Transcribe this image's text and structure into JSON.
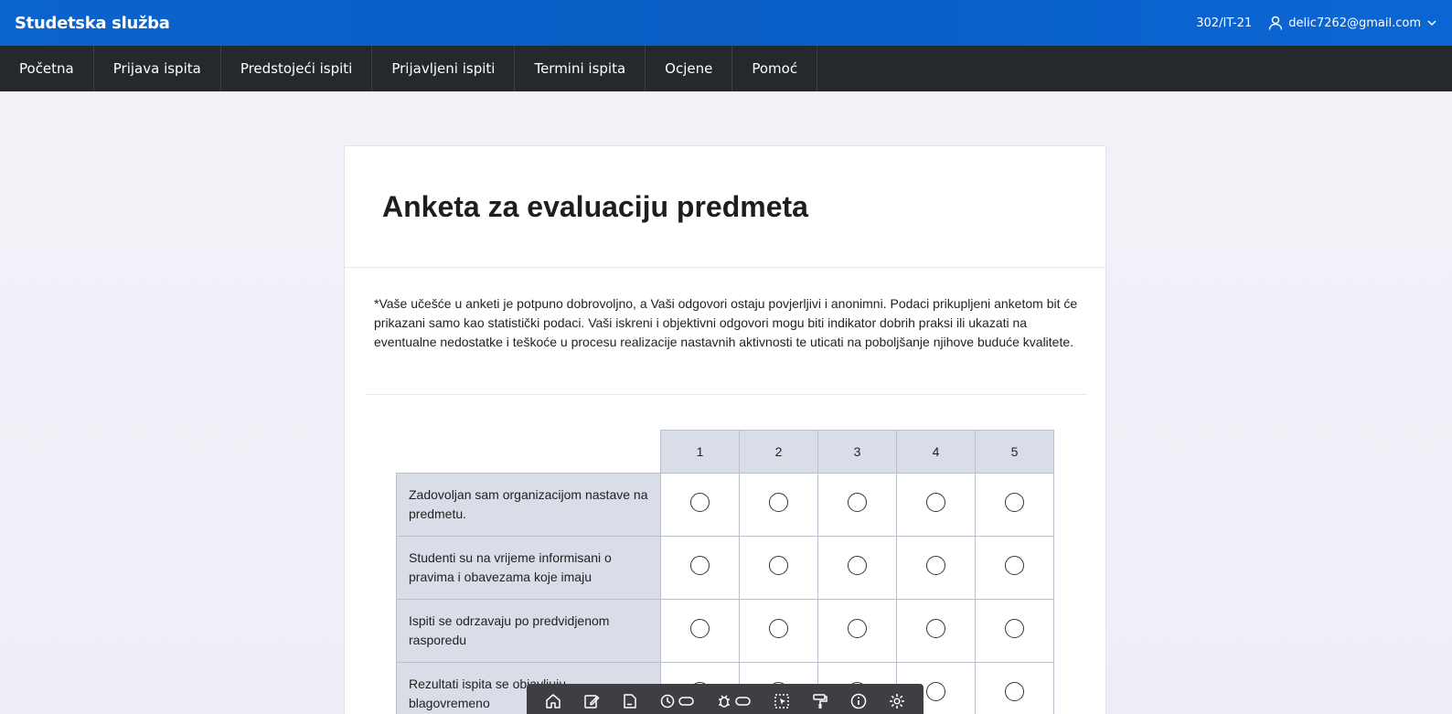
{
  "header": {
    "brand": "Studetska služba",
    "student_code": "302/IT-21",
    "user_email": "delic7262@gmail.com"
  },
  "nav": {
    "items": [
      "Početna",
      "Prijava ispita",
      "Predstojeći ispiti",
      "Prijavljeni ispiti",
      "Termini ispita",
      "Ocjene",
      "Pomoć"
    ]
  },
  "survey": {
    "title": "Anketa za evaluaciju predmeta",
    "intro": "*Vaše učešće u anketi je potpuno dobrovoljno, a Vaši odgovori ostaju povjerljivi i anonimni. Podaci prikupljeni anketom bit će prikazani samo kao statistički podaci. Vaši iskreni i objektivni odgovori mogu biti indikator dobrih praksi ili ukazati na eventualne nedostatke i teškoće u procesu realizacije nastavnih aktivnosti te uticati na poboljšanje njihove buduće kvalitete.",
    "scale": [
      "1",
      "2",
      "3",
      "4",
      "5"
    ],
    "questions": [
      "Zadovoljan sam organizacijom nastave na predmetu.",
      "Studenti su na vrijeme informisani o pravima i obavezama koje imaju",
      "Ispiti se odrzavaju po predvidjenom rasporedu",
      "Rezultati ispita se objavljuju blagovremeno"
    ]
  },
  "toolbar": {
    "icons": [
      "home-icon",
      "edit-icon",
      "sign-icon",
      "history-toggle-icon",
      "bug-toggle-icon",
      "select-icon",
      "paint-roller-icon",
      "info-icon",
      "gear-icon"
    ]
  },
  "colors": {
    "header_blue": "#0b63cc",
    "nav_dark": "#25282d",
    "table_header": "#d9dde8"
  }
}
